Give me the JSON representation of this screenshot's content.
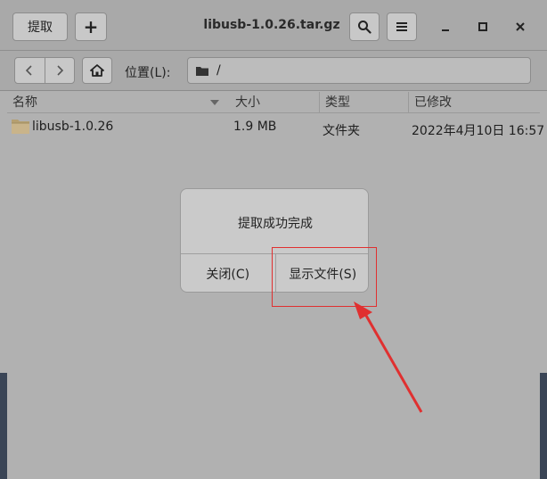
{
  "window": {
    "title": "libusb-1.0.26.tar.gz"
  },
  "header": {
    "extract_label": "提取",
    "add_label": "+"
  },
  "location": {
    "label": "位置(L):",
    "path": "/"
  },
  "columns": [
    {
      "label": "名称"
    },
    {
      "label": "大小"
    },
    {
      "label": "类型"
    },
    {
      "label": "已修改"
    }
  ],
  "files": [
    {
      "name": "libusb-1.0.26",
      "size": "1.9 MB",
      "type": "文件夹",
      "modified": "2022年4月10日 16:57",
      "icon": "folder-icon"
    }
  ],
  "dialog": {
    "message": "提取成功完成",
    "close_label": "关闭(C)",
    "show_files_label": "显示文件(S)"
  },
  "colors": {
    "annotation": "#e03030",
    "folder": "#c9b48a"
  }
}
